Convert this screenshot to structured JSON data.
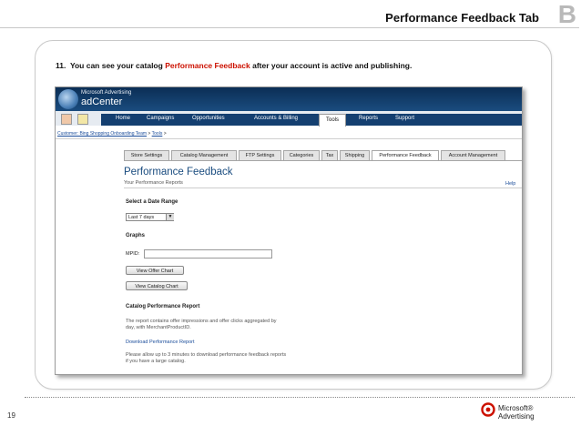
{
  "slide": {
    "title": "Performance Feedback Tab",
    "section_letter": "B",
    "page_number": "19",
    "instruction": {
      "number": "11.",
      "text_before": "You can see your catalog ",
      "highlight": "Performance Feedback",
      "text_after": " after your account is active and publishing."
    },
    "footer_logo": {
      "line1": "Microsoft®",
      "line2": "Advertising"
    }
  },
  "screenshot": {
    "brand": {
      "line1": "Microsoft Advertising",
      "line2": "adCenter"
    },
    "nav": [
      "Home",
      "Campaigns",
      "Opportunities",
      "Accounts & Billing",
      "Tools",
      "Reports",
      "Support"
    ],
    "nav_active": "Tools",
    "breadcrumb": {
      "link": "Customer: Bing Shopping Onboarding Team",
      "sep1": " > ",
      "tools": "Tools",
      "sep2": " >"
    },
    "tabs": [
      "Store Settings",
      "Catalog Management",
      "FTP Settings",
      "Categories",
      "Tax",
      "Shipping",
      "Performance Feedback",
      "Account Management"
    ],
    "selected_tab": "Performance Feedback",
    "page_title": "Performance Feedback",
    "page_subtitle": "Your Performance Reports",
    "help": "Help",
    "date_range_label": "Select a Date Range",
    "date_range_value": "Last 7 days",
    "graphs_label": "Graphs",
    "mpid_label": "MPID:",
    "mpid_value": "",
    "view_offer_chart": "View Offer Chart",
    "view_catalog_chart": "View Catalog Chart",
    "catalog_report_label": "Catalog Performance Report",
    "report_desc_1": "The report contains offer impressions and offer clicks aggregated by",
    "report_desc_2": "day, with MerchantProductID.",
    "download_link": "Download Performance Report",
    "wait_note_1": "Please allow up to 3 minutes to download performance feedback reports",
    "wait_note_2": "if you have a large catalog."
  },
  "colors": {
    "accent_red": "#cc1100",
    "nav_blue": "#143f70",
    "link_blue": "#1a4c9a"
  }
}
